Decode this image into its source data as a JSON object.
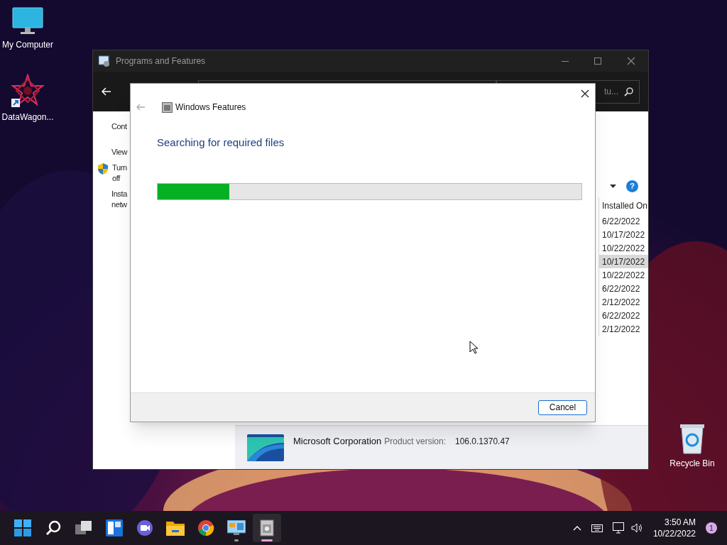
{
  "desktop_icons": [
    {
      "kind": "monitor",
      "label": "My Computer"
    },
    {
      "kind": "star",
      "label": "DataWagon..."
    },
    {
      "kind": "recycle",
      "label": "Recycle Bin"
    }
  ],
  "window": {
    "title": "Programs and Features",
    "search": {
      "placeholder": "tu..."
    },
    "sidebar": [
      "Cont",
      "View",
      "Turn off",
      "Insta netw"
    ],
    "help": "?",
    "column_header": "Installed On",
    "dates": [
      {
        "text": "6/22/2022",
        "selected": false
      },
      {
        "text": "10/17/2022",
        "selected": false
      },
      {
        "text": "10/22/2022",
        "selected": false
      },
      {
        "text": "10/17/2022",
        "selected": true
      },
      {
        "text": "10/22/2022",
        "selected": false
      },
      {
        "text": "6/22/2022",
        "selected": false
      },
      {
        "text": "2/12/2022",
        "selected": false
      },
      {
        "text": "6/22/2022",
        "selected": false
      },
      {
        "text": "2/12/2022",
        "selected": false
      }
    ],
    "details": {
      "publisher": "Microsoft Corporation",
      "label": "Product version:",
      "value": "106.0.1370.47"
    }
  },
  "dialog": {
    "title": "Windows Features",
    "heading": "Searching for required files",
    "progress": {
      "level": 0.17
    },
    "button": "Cancel"
  },
  "taskbar": {
    "apps": [
      {
        "kind": "start",
        "running": false,
        "selected": false
      },
      {
        "kind": "search",
        "running": false,
        "selected": false
      },
      {
        "kind": "taskview",
        "running": false,
        "selected": false
      },
      {
        "kind": "widgets",
        "running": false,
        "selected": false
      },
      {
        "kind": "chat",
        "running": false,
        "selected": false
      },
      {
        "kind": "folder",
        "running": false,
        "selected": false
      },
      {
        "kind": "browser",
        "running": false,
        "selected": false
      },
      {
        "kind": "controlpanel",
        "running": true,
        "selected": false
      },
      {
        "kind": "installer",
        "running": true,
        "selected": true
      }
    ],
    "time": "3:50 AM",
    "date": "10/22/2022",
    "badge": "1"
  }
}
